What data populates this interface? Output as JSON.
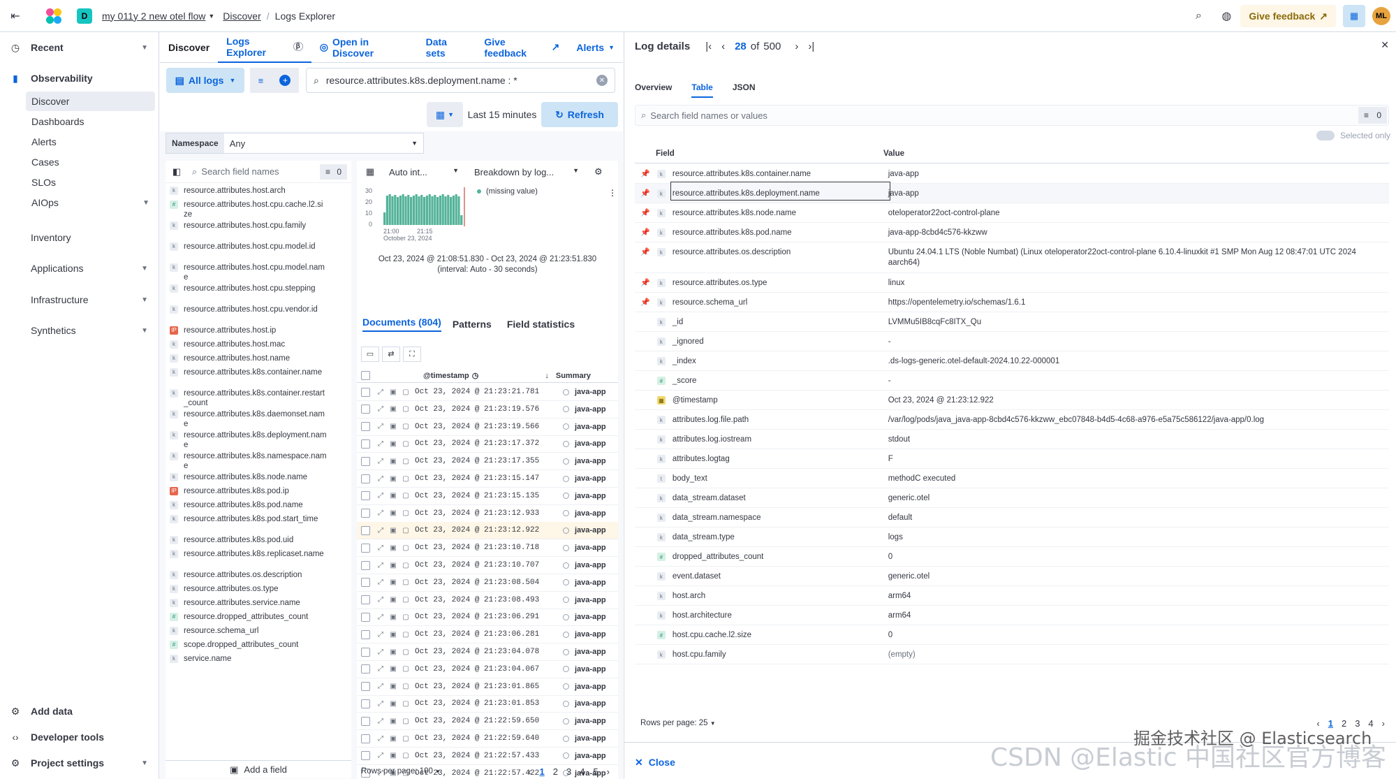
{
  "header": {
    "breadcrumbs": [
      "my 011y 2 new otel flow",
      "Discover",
      "Logs Explorer"
    ],
    "space_badge": "D",
    "feedback_label": "Give feedback",
    "avatar_initials": "ML"
  },
  "nav": {
    "recent": "Recent",
    "observability": "Observability",
    "obs_items": [
      "Discover",
      "Dashboards",
      "Alerts",
      "Cases",
      "SLOs",
      "AIOps"
    ],
    "sections": [
      "Inventory",
      "Applications",
      "Infrastructure",
      "Synthetics"
    ],
    "bottom": [
      "Add data",
      "Developer tools",
      "Project settings"
    ]
  },
  "discover": {
    "tabs": [
      "Discover",
      "Logs Explorer",
      "Open in Discover",
      "Data sets",
      "Give feedback",
      "Alerts"
    ],
    "all_logs": "All logs",
    "query": "resource.attributes.k8s.deployment.name : *",
    "time_label": "Last 15 minutes",
    "refresh": "Refresh",
    "namespace_label": "Namespace",
    "namespace_value": "Any",
    "field_search_placeholder": "Search field names",
    "field_count": "0",
    "fields": [
      {
        "t": "k",
        "n": "resource.attributes.host.arch"
      },
      {
        "t": "#",
        "n": "resource.attributes.host.cpu.cache.l2.size"
      },
      {
        "t": "k",
        "n": "resource.attributes.host.cpu.family"
      },
      {
        "t": "k",
        "n": "resource.attributes.host.cpu.model.id"
      },
      {
        "t": "k",
        "n": "resource.attributes.host.cpu.model.name"
      },
      {
        "t": "k",
        "n": "resource.attributes.host.cpu.stepping"
      },
      {
        "t": "k",
        "n": "resource.attributes.host.cpu.vendor.id"
      },
      {
        "t": "ip",
        "n": "resource.attributes.host.ip"
      },
      {
        "t": "k",
        "n": "resource.attributes.host.mac"
      },
      {
        "t": "k",
        "n": "resource.attributes.host.name"
      },
      {
        "t": "k",
        "n": "resource.attributes.k8s.container.name"
      },
      {
        "t": "k",
        "n": "resource.attributes.k8s.container.restart_count"
      },
      {
        "t": "k",
        "n": "resource.attributes.k8s.daemonset.name"
      },
      {
        "t": "k",
        "n": "resource.attributes.k8s.deployment.name"
      },
      {
        "t": "k",
        "n": "resource.attributes.k8s.namespace.name"
      },
      {
        "t": "k",
        "n": "resource.attributes.k8s.node.name"
      },
      {
        "t": "ip",
        "n": "resource.attributes.k8s.pod.ip"
      },
      {
        "t": "k",
        "n": "resource.attributes.k8s.pod.name"
      },
      {
        "t": "k",
        "n": "resource.attributes.k8s.pod.start_time"
      },
      {
        "t": "k",
        "n": "resource.attributes.k8s.pod.uid"
      },
      {
        "t": "k",
        "n": "resource.attributes.k8s.replicaset.name"
      },
      {
        "t": "k",
        "n": "resource.attributes.os.description"
      },
      {
        "t": "k",
        "n": "resource.attributes.os.type"
      },
      {
        "t": "k",
        "n": "resource.attributes.service.name"
      },
      {
        "t": "#",
        "n": "resource.dropped_attributes_count"
      },
      {
        "t": "k",
        "n": "resource.schema_url"
      },
      {
        "t": "#",
        "n": "scope.dropped_attributes_count"
      },
      {
        "t": "k",
        "n": "service.name"
      }
    ],
    "add_field": "Add a field",
    "interval": "Auto int...",
    "breakdown": "Breakdown by log...",
    "legend": "(missing value)",
    "yticks": [
      "30",
      "20",
      "10",
      "0"
    ],
    "xticks": [
      "21:00",
      "21:15"
    ],
    "xdate": "October 23, 2024",
    "range": "Oct 23, 2024 @ 21:08:51.830 - Oct 23, 2024 @ 21:23:51.830",
    "interval_note": "(interval: Auto - 30 seconds)",
    "doc_tabs": [
      "Documents (804)",
      "Patterns",
      "Field statistics"
    ],
    "col_timestamp": "@timestamp",
    "col_summary": "Summary",
    "rows": [
      "Oct 23, 2024 @ 21:23:21.781",
      "Oct 23, 2024 @ 21:23:19.576",
      "Oct 23, 2024 @ 21:23:19.566",
      "Oct 23, 2024 @ 21:23:17.372",
      "Oct 23, 2024 @ 21:23:17.355",
      "Oct 23, 2024 @ 21:23:15.147",
      "Oct 23, 2024 @ 21:23:15.135",
      "Oct 23, 2024 @ 21:23:12.933",
      "Oct 23, 2024 @ 21:23:12.922",
      "Oct 23, 2024 @ 21:23:10.718",
      "Oct 23, 2024 @ 21:23:10.707",
      "Oct 23, 2024 @ 21:23:08.504",
      "Oct 23, 2024 @ 21:23:08.493",
      "Oct 23, 2024 @ 21:23:06.291",
      "Oct 23, 2024 @ 21:23:06.281",
      "Oct 23, 2024 @ 21:23:04.078",
      "Oct 23, 2024 @ 21:23:04.067",
      "Oct 23, 2024 @ 21:23:01.865",
      "Oct 23, 2024 @ 21:23:01.853",
      "Oct 23, 2024 @ 21:22:59.650",
      "Oct 23, 2024 @ 21:22:59.640",
      "Oct 23, 2024 @ 21:22:57.433",
      "Oct 23, 2024 @ 21:22:57.422"
    ],
    "row_app": "java-app",
    "rows_per_page": "Rows per page: 100",
    "pages": [
      "1",
      "2",
      "3",
      "4",
      "5"
    ]
  },
  "details": {
    "title": "Log details",
    "current": "28",
    "of": "of",
    "total": "500",
    "tabs": [
      "Overview",
      "Table",
      "JSON"
    ],
    "search_placeholder": "Search field names or values",
    "filter_count": "0",
    "selected_only": "Selected only",
    "col_field": "Field",
    "col_value": "Value",
    "rows": [
      {
        "p": true,
        "t": "k",
        "f": "resource.attributes.k8s.container.name",
        "v": "java-app"
      },
      {
        "p": true,
        "t": "k",
        "f": "resource.attributes.k8s.deployment.name",
        "v": "java-app"
      },
      {
        "p": true,
        "t": "k",
        "f": "resource.attributes.k8s.node.name",
        "v": "oteloperator22oct-control-plane"
      },
      {
        "p": true,
        "t": "k",
        "f": "resource.attributes.k8s.pod.name",
        "v": "java-app-8cbd4c576-kkzww"
      },
      {
        "p": true,
        "t": "k",
        "f": "resource.attributes.os.description",
        "v": "Ubuntu 24.04.1 LTS (Noble Numbat) (Linux oteloperator22oct-control-plane 6.10.4-linuxkit #1 SMP Mon Aug 12 08:47:01 UTC 2024 aarch64)"
      },
      {
        "p": true,
        "t": "k",
        "f": "resource.attributes.os.type",
        "v": "linux"
      },
      {
        "p": true,
        "t": "k",
        "f": "resource.schema_url",
        "v": "https://opentelemetry.io/schemas/1.6.1"
      },
      {
        "p": false,
        "t": "k",
        "f": "_id",
        "v": "LVMMu5IB8cqFc8ITX_Qu"
      },
      {
        "p": false,
        "t": "k",
        "f": "_ignored",
        "v": "-"
      },
      {
        "p": false,
        "t": "k",
        "f": "_index",
        "v": ".ds-logs-generic.otel-default-2024.10.22-000001"
      },
      {
        "p": false,
        "t": "#",
        "f": "_score",
        "v": "-"
      },
      {
        "p": false,
        "t": "d",
        "f": "@timestamp",
        "v": "Oct 23, 2024 @ 21:23:12.922"
      },
      {
        "p": false,
        "t": "k",
        "f": "attributes.log.file.path",
        "v": "/var/log/pods/java_java-app-8cbd4c576-kkzww_ebc07848-b4d5-4c68-a976-e5a75c586122/java-app/0.log"
      },
      {
        "p": false,
        "t": "k",
        "f": "attributes.log.iostream",
        "v": "stdout"
      },
      {
        "p": false,
        "t": "k",
        "f": "attributes.logtag",
        "v": "F"
      },
      {
        "p": false,
        "t": "t",
        "f": "body_text",
        "v": "methodC executed"
      },
      {
        "p": false,
        "t": "k",
        "f": "data_stream.dataset",
        "v": "generic.otel"
      },
      {
        "p": false,
        "t": "k",
        "f": "data_stream.namespace",
        "v": "default"
      },
      {
        "p": false,
        "t": "k",
        "f": "data_stream.type",
        "v": "logs"
      },
      {
        "p": false,
        "t": "#",
        "f": "dropped_attributes_count",
        "v": "0"
      },
      {
        "p": false,
        "t": "k",
        "f": "event.dataset",
        "v": "generic.otel"
      },
      {
        "p": false,
        "t": "k",
        "f": "host.arch",
        "v": "arm64"
      },
      {
        "p": false,
        "t": "k",
        "f": "host.architecture",
        "v": "arm64"
      },
      {
        "p": false,
        "t": "#",
        "f": "host.cpu.cache.l2.size",
        "v": "0"
      },
      {
        "p": false,
        "t": "k",
        "f": "host.cpu.family",
        "v": "(empty)"
      }
    ],
    "rows_per_page": "Rows per page: 25",
    "pages": [
      "1",
      "2",
      "3",
      "4"
    ],
    "close": "Close"
  },
  "watermark": "CSDN @Elastic 中国社区官方博客",
  "watermark2": "掘金技术社区 @ Elasticsearch",
  "colors": {
    "accent": "#0b64dd",
    "bars": "#54b399",
    "feedback_bg": "#fef6e6"
  }
}
